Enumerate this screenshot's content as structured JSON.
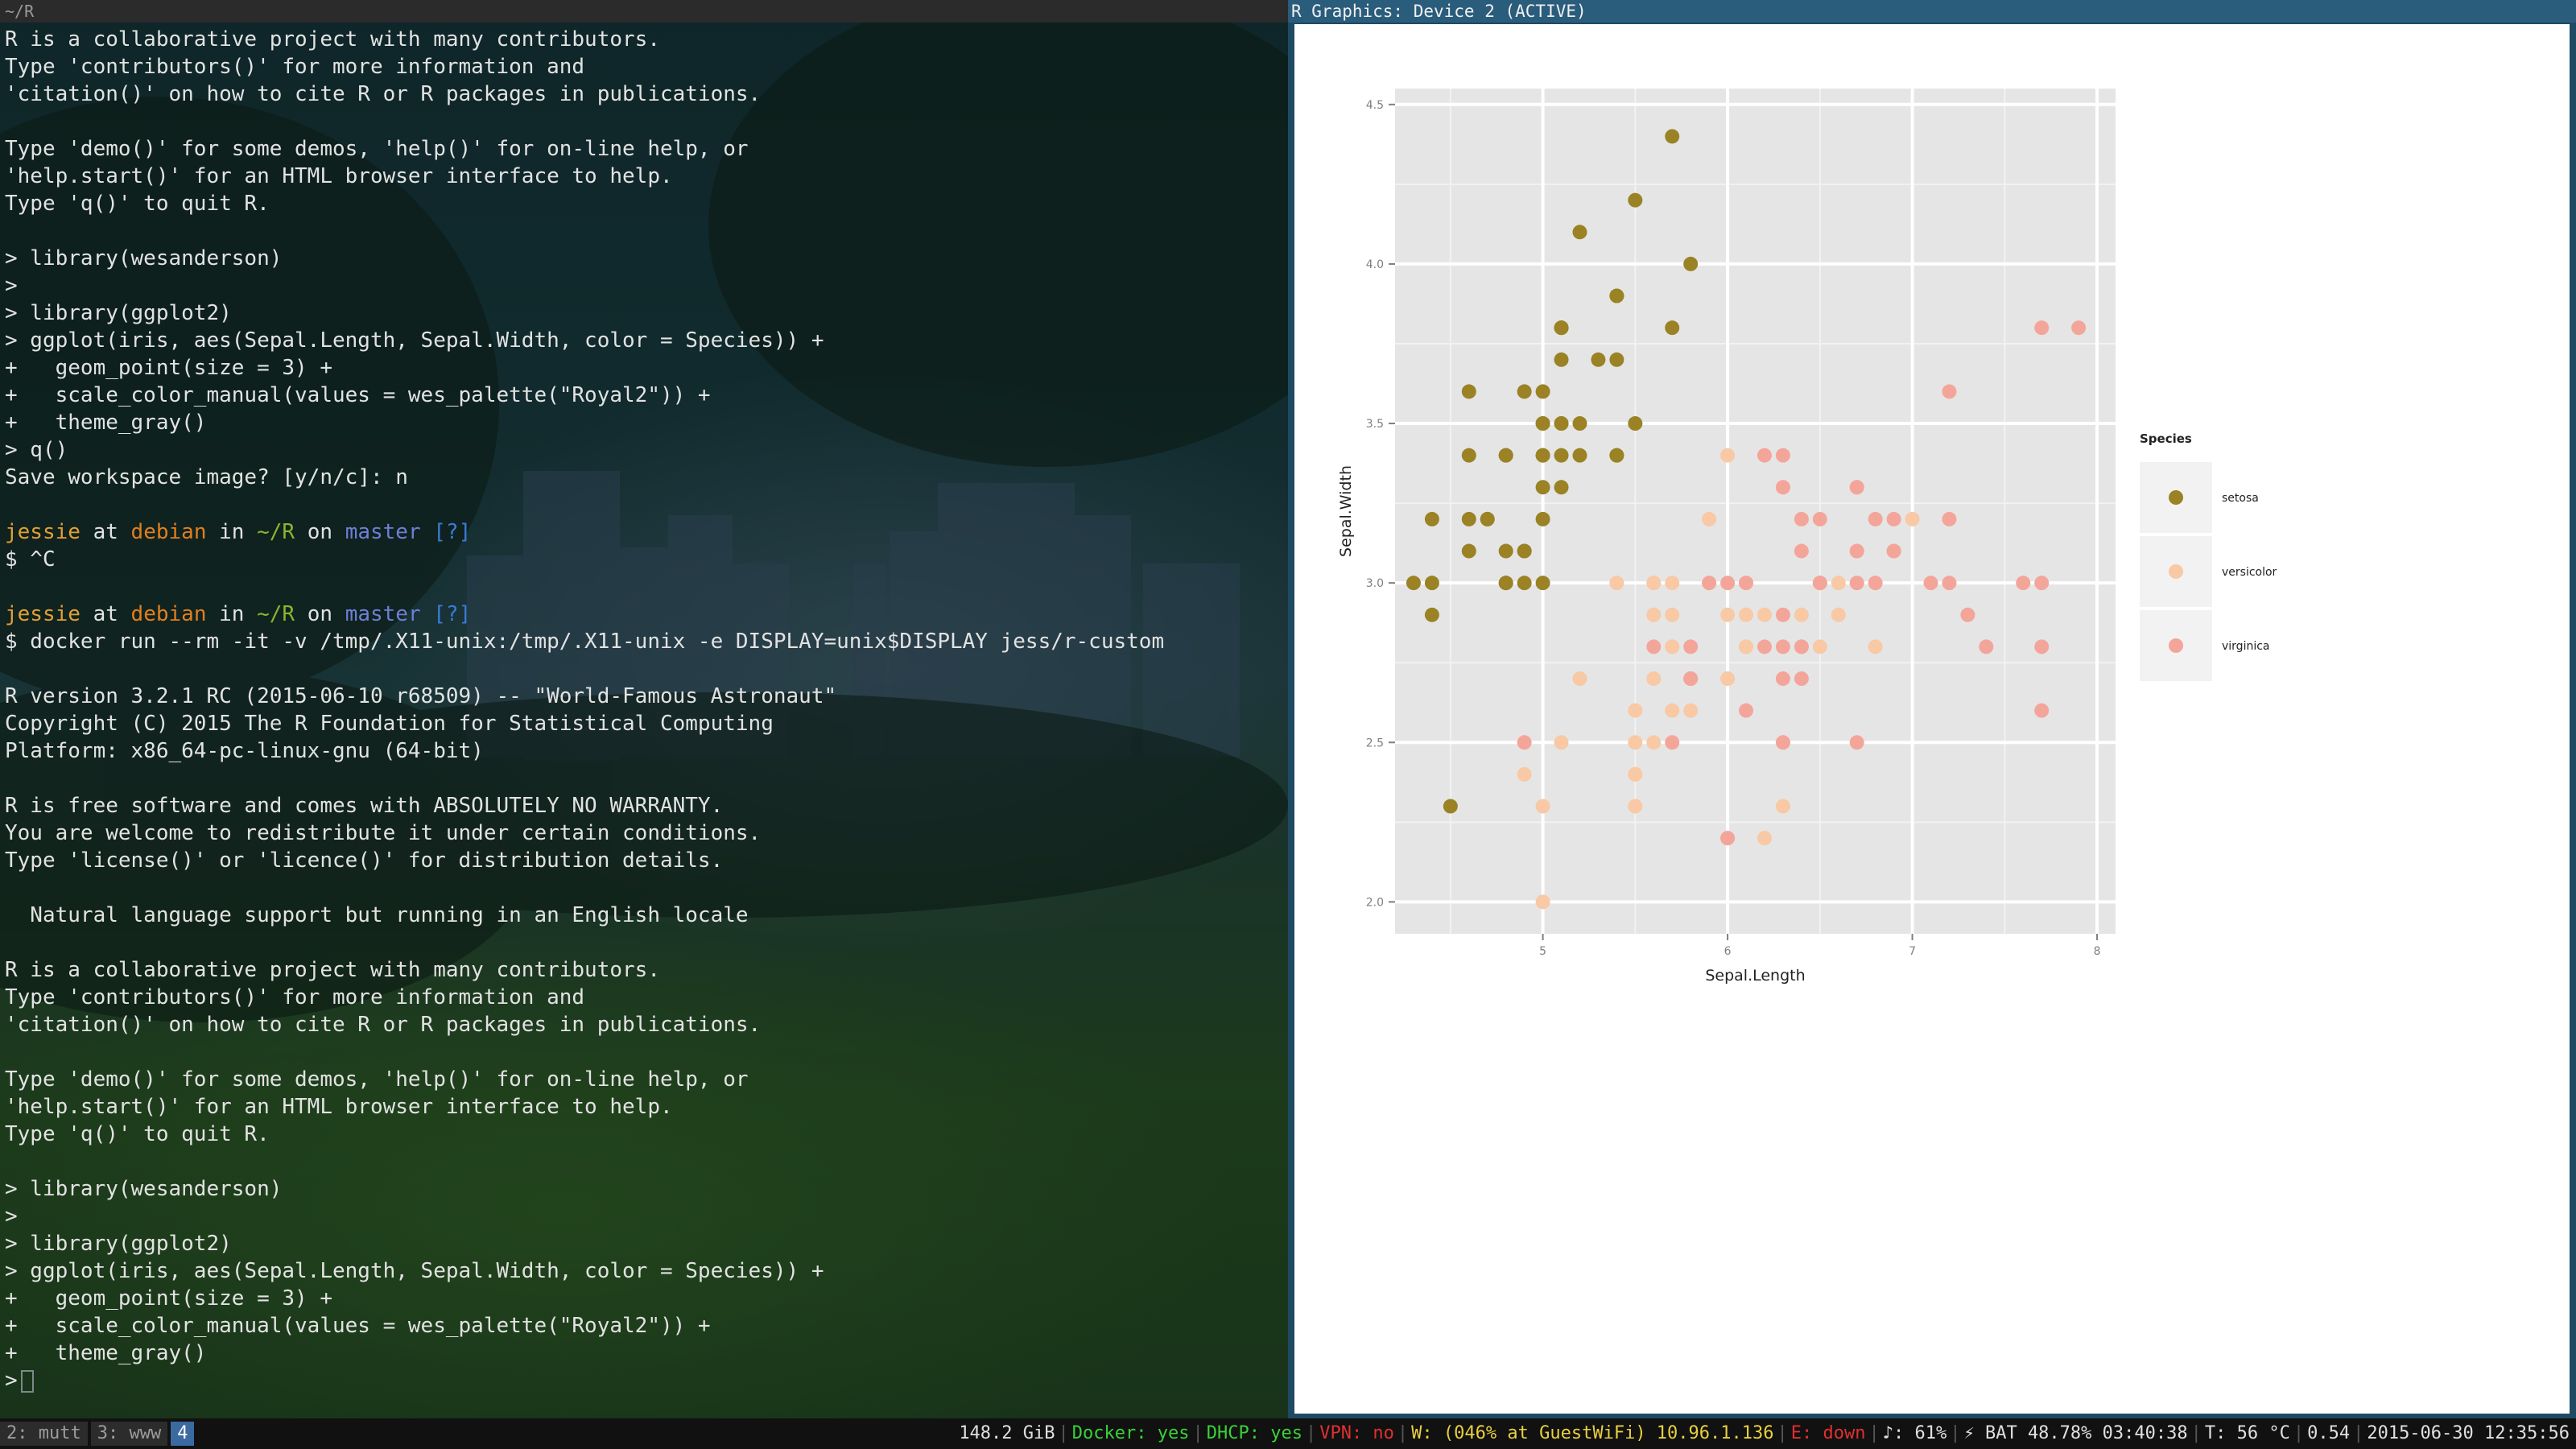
{
  "terminal": {
    "title": "~/R",
    "lines": [
      {
        "segments": [
          {
            "t": "R is a collaborative project with many contributors."
          }
        ]
      },
      {
        "segments": [
          {
            "t": "Type 'contributors()' for more information and"
          }
        ]
      },
      {
        "segments": [
          {
            "t": "'citation()' on how to cite R or R packages in publications."
          }
        ]
      },
      {
        "segments": [
          {
            "t": ""
          }
        ]
      },
      {
        "segments": [
          {
            "t": "Type 'demo()' for some demos, 'help()' for on-line help, or"
          }
        ]
      },
      {
        "segments": [
          {
            "t": "'help.start()' for an HTML browser interface to help."
          }
        ]
      },
      {
        "segments": [
          {
            "t": "Type 'q()' to quit R."
          }
        ]
      },
      {
        "segments": [
          {
            "t": ""
          }
        ]
      },
      {
        "segments": [
          {
            "t": "> library(wesanderson)"
          }
        ]
      },
      {
        "segments": [
          {
            "t": ">"
          }
        ]
      },
      {
        "segments": [
          {
            "t": "> library(ggplot2)"
          }
        ]
      },
      {
        "segments": [
          {
            "t": "> ggplot(iris, aes(Sepal.Length, Sepal.Width, color = Species)) +"
          }
        ]
      },
      {
        "segments": [
          {
            "t": "+   geom_point(size = 3) +"
          }
        ]
      },
      {
        "segments": [
          {
            "t": "+   scale_color_manual(values = wes_palette(\"Royal2\")) +"
          }
        ]
      },
      {
        "segments": [
          {
            "t": "+   theme_gray()"
          }
        ]
      },
      {
        "segments": [
          {
            "t": "> q()"
          }
        ]
      },
      {
        "segments": [
          {
            "t": "Save workspace image? [y/n/c]: n"
          }
        ]
      },
      {
        "segments": [
          {
            "t": ""
          }
        ]
      },
      {
        "segments": [
          {
            "t": "jessie",
            "c": "c-user"
          },
          {
            "t": " at "
          },
          {
            "t": "debian",
            "c": "c-host"
          },
          {
            "t": " in "
          },
          {
            "t": "~/R",
            "c": "c-path"
          },
          {
            "t": " on "
          },
          {
            "t": "master",
            "c": "c-branch"
          },
          {
            "t": " "
          },
          {
            "t": "[?]",
            "c": "c-flag"
          }
        ]
      },
      {
        "segments": [
          {
            "t": "$ ^C"
          }
        ]
      },
      {
        "segments": [
          {
            "t": ""
          }
        ]
      },
      {
        "segments": [
          {
            "t": "jessie",
            "c": "c-user"
          },
          {
            "t": " at "
          },
          {
            "t": "debian",
            "c": "c-host"
          },
          {
            "t": " in "
          },
          {
            "t": "~/R",
            "c": "c-path"
          },
          {
            "t": " on "
          },
          {
            "t": "master",
            "c": "c-branch"
          },
          {
            "t": " "
          },
          {
            "t": "[?]",
            "c": "c-flag"
          }
        ]
      },
      {
        "segments": [
          {
            "t": "$ docker run --rm -it -v /tmp/.X11-unix:/tmp/.X11-unix -e DISPLAY=unix$DISPLAY jess/r-custom"
          }
        ]
      },
      {
        "segments": [
          {
            "t": ""
          }
        ]
      },
      {
        "segments": [
          {
            "t": "R version 3.2.1 RC (2015-06-10 r68509) -- \"World-Famous Astronaut\""
          }
        ]
      },
      {
        "segments": [
          {
            "t": "Copyright (C) 2015 The R Foundation for Statistical Computing"
          }
        ]
      },
      {
        "segments": [
          {
            "t": "Platform: x86_64-pc-linux-gnu (64-bit)"
          }
        ]
      },
      {
        "segments": [
          {
            "t": ""
          }
        ]
      },
      {
        "segments": [
          {
            "t": "R is free software and comes with ABSOLUTELY NO WARRANTY."
          }
        ]
      },
      {
        "segments": [
          {
            "t": "You are welcome to redistribute it under certain conditions."
          }
        ]
      },
      {
        "segments": [
          {
            "t": "Type 'license()' or 'licence()' for distribution details."
          }
        ]
      },
      {
        "segments": [
          {
            "t": ""
          }
        ]
      },
      {
        "segments": [
          {
            "t": "  Natural language support but running in an English locale"
          }
        ]
      },
      {
        "segments": [
          {
            "t": ""
          }
        ]
      },
      {
        "segments": [
          {
            "t": "R is a collaborative project with many contributors."
          }
        ]
      },
      {
        "segments": [
          {
            "t": "Type 'contributors()' for more information and"
          }
        ]
      },
      {
        "segments": [
          {
            "t": "'citation()' on how to cite R or R packages in publications."
          }
        ]
      },
      {
        "segments": [
          {
            "t": ""
          }
        ]
      },
      {
        "segments": [
          {
            "t": "Type 'demo()' for some demos, 'help()' for on-line help, or"
          }
        ]
      },
      {
        "segments": [
          {
            "t": "'help.start()' for an HTML browser interface to help."
          }
        ]
      },
      {
        "segments": [
          {
            "t": "Type 'q()' to quit R."
          }
        ]
      },
      {
        "segments": [
          {
            "t": ""
          }
        ]
      },
      {
        "segments": [
          {
            "t": "> library(wesanderson)"
          }
        ]
      },
      {
        "segments": [
          {
            "t": ">"
          }
        ]
      },
      {
        "segments": [
          {
            "t": "> library(ggplot2)"
          }
        ]
      },
      {
        "segments": [
          {
            "t": "> ggplot(iris, aes(Sepal.Length, Sepal.Width, color = Species)) +"
          }
        ]
      },
      {
        "segments": [
          {
            "t": "+   geom_point(size = 3) +"
          }
        ]
      },
      {
        "segments": [
          {
            "t": "+   scale_color_manual(values = wes_palette(\"Royal2\")) +"
          }
        ]
      },
      {
        "segments": [
          {
            "t": "+   theme_gray()"
          }
        ]
      },
      {
        "segments": [
          {
            "t": ">"
          }
        ],
        "cursor": true
      }
    ]
  },
  "graphics_window": {
    "title": "R Graphics: Device 2 (ACTIVE)"
  },
  "chart_data": {
    "type": "scatter",
    "title": "",
    "xlabel": "Sepal.Length",
    "ylabel": "Sepal.Width",
    "xlim": [
      4.2,
      8.1
    ],
    "ylim": [
      1.9,
      4.55
    ],
    "xticks": [
      5,
      6,
      7,
      8
    ],
    "yticks": [
      2.0,
      2.5,
      3.0,
      3.5,
      4.0,
      4.5
    ],
    "ytick_labels": [
      "2.0",
      "2.5",
      "3.0",
      "3.5",
      "4.0",
      "4.5"
    ],
    "grid": true,
    "legend": {
      "title": "Species",
      "placement": "right"
    },
    "series": [
      {
        "name": "setosa",
        "color": "#9a8225",
        "x": [
          5.1,
          4.9,
          4.7,
          4.6,
          5.0,
          5.4,
          4.6,
          5.0,
          4.4,
          4.9,
          5.4,
          4.8,
          4.8,
          4.3,
          5.8,
          5.7,
          5.4,
          5.1,
          5.7,
          5.1,
          5.4,
          5.1,
          4.6,
          5.1,
          4.8,
          5.0,
          5.0,
          5.2,
          5.2,
          4.7,
          4.8,
          5.4,
          5.2,
          5.5,
          4.9,
          5.0,
          5.5,
          4.9,
          4.4,
          5.1,
          5.0,
          4.5,
          4.4,
          5.0,
          5.1,
          4.8,
          5.1,
          4.6,
          5.3,
          5.0
        ],
        "y": [
          3.5,
          3.0,
          3.2,
          3.1,
          3.6,
          3.9,
          3.4,
          3.4,
          2.9,
          3.1,
          3.7,
          3.4,
          3.0,
          3.0,
          4.0,
          4.4,
          3.9,
          3.5,
          3.8,
          3.8,
          3.4,
          3.7,
          3.6,
          3.3,
          3.4,
          3.0,
          3.4,
          3.5,
          3.4,
          3.2,
          3.1,
          3.4,
          4.1,
          4.2,
          3.1,
          3.2,
          3.5,
          3.6,
          3.0,
          3.4,
          3.5,
          2.3,
          3.2,
          3.5,
          3.8,
          3.0,
          3.8,
          3.2,
          3.7,
          3.3
        ]
      },
      {
        "name": "versicolor",
        "color": "#f8c9a4",
        "x": [
          7.0,
          6.4,
          6.9,
          5.5,
          6.5,
          5.7,
          6.3,
          4.9,
          6.6,
          5.2,
          5.0,
          5.9,
          6.0,
          6.1,
          5.6,
          6.7,
          5.6,
          5.8,
          6.2,
          5.6,
          5.9,
          6.1,
          6.3,
          6.1,
          6.4,
          6.6,
          6.8,
          6.7,
          6.0,
          5.7,
          5.5,
          5.5,
          5.8,
          6.0,
          5.4,
          6.0,
          6.7,
          6.3,
          5.6,
          5.5,
          5.5,
          6.1,
          5.8,
          5.0,
          5.6,
          5.7,
          5.7,
          6.2,
          5.1,
          5.7
        ],
        "y": [
          3.2,
          3.2,
          3.1,
          2.3,
          2.8,
          2.8,
          3.3,
          2.4,
          2.9,
          2.7,
          2.0,
          3.0,
          2.2,
          2.9,
          2.9,
          3.1,
          3.0,
          2.7,
          2.2,
          2.5,
          3.2,
          2.8,
          2.5,
          2.8,
          2.9,
          3.0,
          2.8,
          3.0,
          2.9,
          2.6,
          2.4,
          2.4,
          2.7,
          2.7,
          3.0,
          3.4,
          3.1,
          2.3,
          3.0,
          2.5,
          2.6,
          3.0,
          2.6,
          2.3,
          2.7,
          3.0,
          2.9,
          2.9,
          2.5,
          2.8
        ]
      },
      {
        "name": "virginica",
        "color": "#f4a59a",
        "x": [
          6.3,
          5.8,
          7.1,
          6.3,
          6.5,
          7.6,
          4.9,
          7.3,
          6.7,
          7.2,
          6.5,
          6.4,
          6.8,
          5.7,
          5.8,
          6.4,
          6.5,
          7.7,
          7.7,
          6.0,
          6.9,
          5.6,
          7.7,
          6.3,
          6.7,
          7.2,
          6.2,
          6.1,
          6.4,
          7.2,
          7.4,
          7.9,
          6.4,
          6.3,
          6.1,
          7.7,
          6.3,
          6.4,
          6.0,
          6.9,
          6.7,
          6.9,
          5.8,
          6.8,
          6.7,
          6.7,
          6.3,
          6.5,
          6.2,
          5.9
        ],
        "y": [
          3.3,
          2.7,
          3.0,
          2.9,
          3.0,
          3.0,
          2.5,
          2.9,
          2.5,
          3.6,
          3.2,
          2.7,
          3.0,
          2.5,
          2.8,
          3.2,
          3.0,
          3.8,
          2.6,
          2.2,
          3.2,
          2.8,
          2.8,
          2.7,
          3.3,
          3.2,
          2.8,
          3.0,
          2.8,
          3.0,
          2.8,
          3.8,
          2.8,
          2.8,
          2.6,
          3.0,
          3.4,
          3.1,
          3.0,
          3.1,
          3.1,
          3.1,
          2.7,
          3.2,
          3.3,
          3.0,
          2.5,
          3.0,
          3.4,
          3.0
        ]
      }
    ]
  },
  "statusbar": {
    "workspaces": [
      {
        "label": "2: mutt",
        "active": false
      },
      {
        "label": "3: www",
        "active": false
      },
      {
        "label": "4",
        "active": true
      }
    ],
    "items": [
      {
        "text": "148.2 GiB",
        "color": "white"
      },
      {
        "text": "Docker: yes",
        "color": "green"
      },
      {
        "text": "DHCP: yes",
        "color": "green"
      },
      {
        "text": "VPN: no",
        "color": "red"
      },
      {
        "text": "W: (046% at GuestWiFi) 10.96.1.136",
        "color": "yellow"
      },
      {
        "text": "E: down",
        "color": "red"
      },
      {
        "text": "♪: 61%",
        "color": "white"
      },
      {
        "text": "⚡ BAT 48.78% 03:40:38",
        "color": "white"
      },
      {
        "text": "T: 56 °C",
        "color": "white"
      },
      {
        "text": "0.54",
        "color": "white"
      },
      {
        "text": "2015-06-30 12:35:56",
        "color": "white"
      }
    ]
  }
}
